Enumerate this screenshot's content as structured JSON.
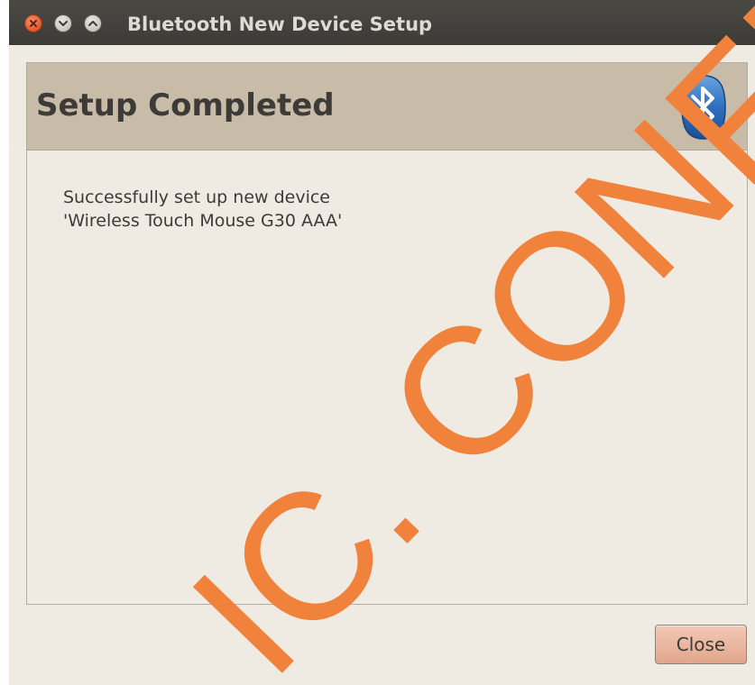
{
  "window": {
    "title": "Bluetooth New Device Setup"
  },
  "header": {
    "heading": "Setup Completed",
    "icon": "bluetooth-icon"
  },
  "message": {
    "line1": "Successfully set up new device",
    "line2": "'Wireless Touch Mouse G30 AAA'"
  },
  "buttons": {
    "close_label": "Close"
  },
  "watermark": {
    "text": "IC. CONFID",
    "color": "#f0823c"
  },
  "colors": {
    "titlebar": "#3c3b37",
    "banner": "#c8bba7",
    "window_bg": "#f0ebe2",
    "close_accent": "#e1562a"
  }
}
